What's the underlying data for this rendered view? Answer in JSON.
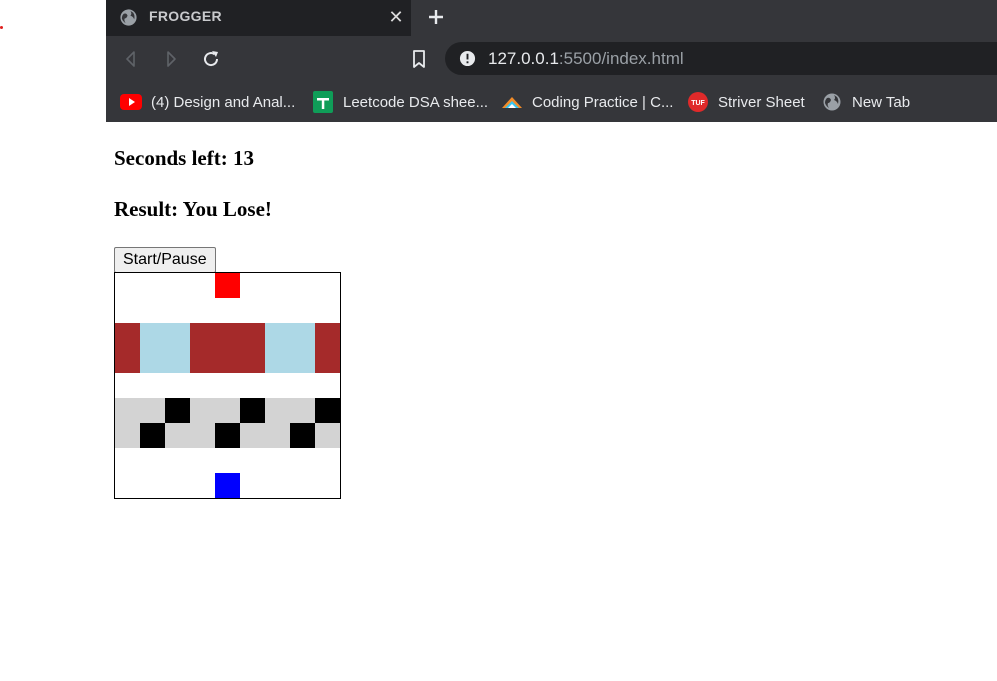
{
  "browser": {
    "tab": {
      "title": "FROGGER",
      "icon": "globe-icon"
    },
    "url": {
      "host": "127.0.0.1",
      "rest": ":5500/index.html"
    },
    "bookmarks": [
      {
        "label": "(4) Design and Anal...",
        "icon": "youtube-icon"
      },
      {
        "label": "Leetcode DSA shee...",
        "icon": "google-sheets-icon"
      },
      {
        "label": "Coding Practice | C...",
        "icon": "codingninjas-icon"
      },
      {
        "label": "Striver Sheet",
        "icon": "tuf-icon"
      },
      {
        "label": "New Tab",
        "icon": "globe-icon"
      }
    ]
  },
  "game": {
    "seconds_label": "Seconds left: 13",
    "result_label": "Result: You Lose!",
    "start_button": "Start/Pause",
    "colors": {
      "empty": "#ffffff",
      "frog": "#0000ff",
      "ending": "#ff0000",
      "log": "#a52a2a",
      "water": "#add8e6",
      "car": "#000000",
      "road": "#d3d3d3"
    },
    "rows": [
      [
        "empty",
        "empty",
        "empty",
        "empty",
        "ending",
        "empty",
        "empty",
        "empty",
        "empty"
      ],
      [
        "empty",
        "empty",
        "empty",
        "empty",
        "empty",
        "empty",
        "empty",
        "empty",
        "empty"
      ],
      [
        "log",
        "water",
        "water",
        "log",
        "log",
        "log",
        "water",
        "water",
        "log"
      ],
      [
        "log",
        "water",
        "water",
        "log",
        "log",
        "log",
        "water",
        "water",
        "log"
      ],
      [
        "empty",
        "empty",
        "empty",
        "empty",
        "empty",
        "empty",
        "empty",
        "empty",
        "empty"
      ],
      [
        "road",
        "road",
        "car",
        "road",
        "road",
        "car",
        "road",
        "road",
        "car"
      ],
      [
        "road",
        "car",
        "road",
        "road",
        "car",
        "road",
        "road",
        "car",
        "road"
      ],
      [
        "empty",
        "empty",
        "empty",
        "empty",
        "empty",
        "empty",
        "empty",
        "empty",
        "empty"
      ],
      [
        "empty",
        "empty",
        "empty",
        "empty",
        "frog",
        "empty",
        "empty",
        "empty",
        "empty"
      ]
    ]
  }
}
